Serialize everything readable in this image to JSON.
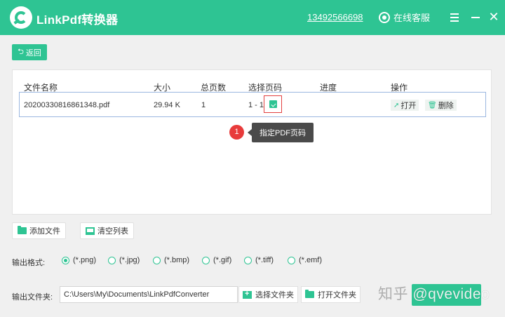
{
  "titlebar": {
    "title": "LinkPdf转换器",
    "phone": "13492566698",
    "service": "在线客服",
    "close": "✕"
  },
  "nav": {
    "back_label": "返回"
  },
  "table": {
    "headers": [
      "文件名称",
      "大小",
      "总页数",
      "选择页码",
      "进度",
      "操作"
    ],
    "rows": [
      {
        "name": "20200330816861348.pdf",
        "size": "29.94 K",
        "pages": "1",
        "page_range": "1 - 1",
        "open": "打开",
        "delete": "删除"
      }
    ]
  },
  "callout": {
    "number": "1",
    "text": "指定PDF页码"
  },
  "actions": {
    "add_file": "添加文件",
    "clear_list": "清空列表"
  },
  "output_format": {
    "label": "输出格式:",
    "options": [
      "(*.png)",
      "(*.jpg)",
      "(*.bmp)",
      "(*.gif)",
      "(*.tiff)",
      "(*.emf)"
    ],
    "selected": "(*.png)"
  },
  "output_folder": {
    "label": "输出文件夹:",
    "path": "C:\\Users\\My\\Documents\\LinkPdfConverter",
    "choose_label": "选择文件夹",
    "open_label": "打开文件夹"
  },
  "watermark": {
    "text_left": "知乎",
    "text_right": "@qvevideo"
  },
  "colors": {
    "accent": "#2ec493",
    "callout_red": "#e83b3b",
    "tooltip_bg": "#4a4a4a"
  }
}
